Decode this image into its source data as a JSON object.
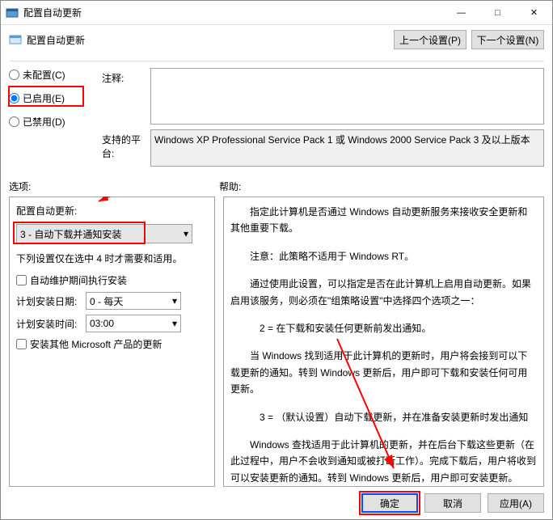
{
  "window": {
    "title": "配置自动更新"
  },
  "policy_title": "配置自动更新",
  "nav": {
    "prev": "上一个设置(P)",
    "next": "下一个设置(N)"
  },
  "radios": {
    "not_configured": "未配置(C)",
    "enabled": "已启用(E)",
    "disabled": "已禁用(D)"
  },
  "labels": {
    "comment": "注释:",
    "platform": "支持的平台:",
    "options": "选项:",
    "help": "帮助:"
  },
  "platform_text": "Windows XP Professional Service Pack 1 或 Windows 2000 Service Pack 3 及以上版本",
  "options": {
    "group_label": "配置自动更新:",
    "mode_selected": "3 - 自动下载并通知安装",
    "note": "下列设置仅在选中 4 时才需要和适用。",
    "maint_checkbox": "自动维护期间执行安装",
    "sched_day_label": "计划安装日期:",
    "sched_day_value": "0 - 每天",
    "sched_time_label": "计划安装时间:",
    "sched_time_value": "03:00",
    "other_ms_checkbox": "安装其他 Microsoft 产品的更新"
  },
  "help": {
    "p1": "指定此计算机是否通过 Windows 自动更新服务来接收安全更新和其他重要下载。",
    "p2": "注意：此策略不适用于 Windows RT。",
    "p3": "通过使用此设置，可以指定是否在此计算机上启用自动更新。如果启用该服务，则必须在\"组策略设置\"中选择四个选项之一：",
    "p4": "2 = 在下载和安装任何更新前发出通知。",
    "p5": "当 Windows 找到适用于此计算机的更新时，用户将会接到可以下载更新的通知。转到 Windows 更新后，用户即可下载和安装任何可用更新。",
    "p6": "3 = （默认设置）自动下载更新，并在准备安装更新时发出通知",
    "p7": "Windows 查找适用于此计算机的更新，并在后台下载这些更新（在此过程中，用户不会收到通知或被打断工作）。完成下载后，用户将收到可以安装更新的通知。转到 Windows 更新后，用户即可安装更新。"
  },
  "buttons": {
    "ok": "确定",
    "cancel": "取消",
    "apply": "应用(A)"
  }
}
